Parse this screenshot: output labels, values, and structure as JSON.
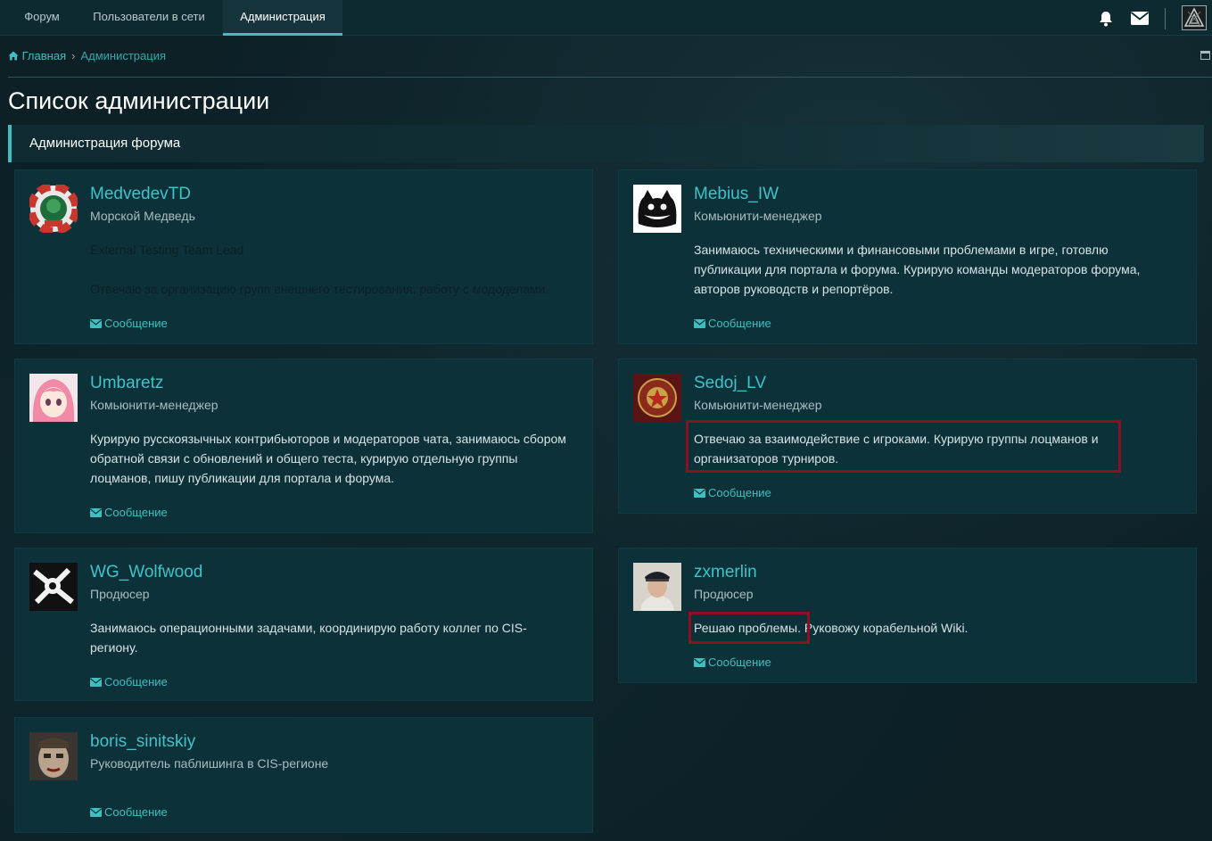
{
  "nav": {
    "tabs": [
      "Форум",
      "Пользователи в сети",
      "Администрация"
    ],
    "icons": [
      "bell-icon",
      "envelope-icon"
    ]
  },
  "breadcrumb": {
    "home": "Главная",
    "current": "Администрация"
  },
  "page_title": "Список администрации",
  "section_title": "Администрация форума",
  "message_label": "Сообщение",
  "cards": [
    {
      "name": "MedvedevTD",
      "title": "Морской Медведь",
      "desc": [
        "External Testing Team Lead",
        "Отвечаю за организацию групп внешнего тестирования, работу с мододелами."
      ]
    },
    {
      "name": "Mebius_IW",
      "title": "Комьюнити-менеджер",
      "desc": [
        "Занимаюсь техническими и финансовыми проблемами в игре, готовлю",
        "публикации для портала и форума. Курирую команды модераторов форума,",
        "авторов руководств и репортёров."
      ]
    },
    {
      "name": "Umbaretz",
      "title": "Комьюнити-менеджер",
      "desc": [
        "Курирую русскоязычных контрибьюторов и модераторов чата, занимаюсь сбором",
        "обратной связи с обновлений и общего теста, курирую отдельную группы",
        "лоцманов, пишу публикации для портала и форума."
      ]
    },
    {
      "name": "Sedoj_LV",
      "title": "Комьюнити-менеджер",
      "desc": [
        "Отвечаю за взаимодействие с игроками. Курирую группы лоцманов и",
        "организаторов турниров."
      ]
    },
    {
      "name": "WG_Wolfwood",
      "title": "Продюсер",
      "desc": [
        "Занимаюсь операционными задачами, координирую работу коллег по CIS-",
        "региону."
      ]
    },
    {
      "name": "zxmerlin",
      "title": "Продюсер",
      "desc": [
        "Решаю проблемы. Руковожу корабельной Wiki."
      ]
    },
    {
      "name": "boris_sinitskiy",
      "title": "Руководитель паблишинга в CIS-регионе",
      "desc": []
    }
  ],
  "colors": {
    "accent": "#3fbfc0",
    "card_bg": "#0d3139",
    "highlight": "#8c0f22"
  }
}
